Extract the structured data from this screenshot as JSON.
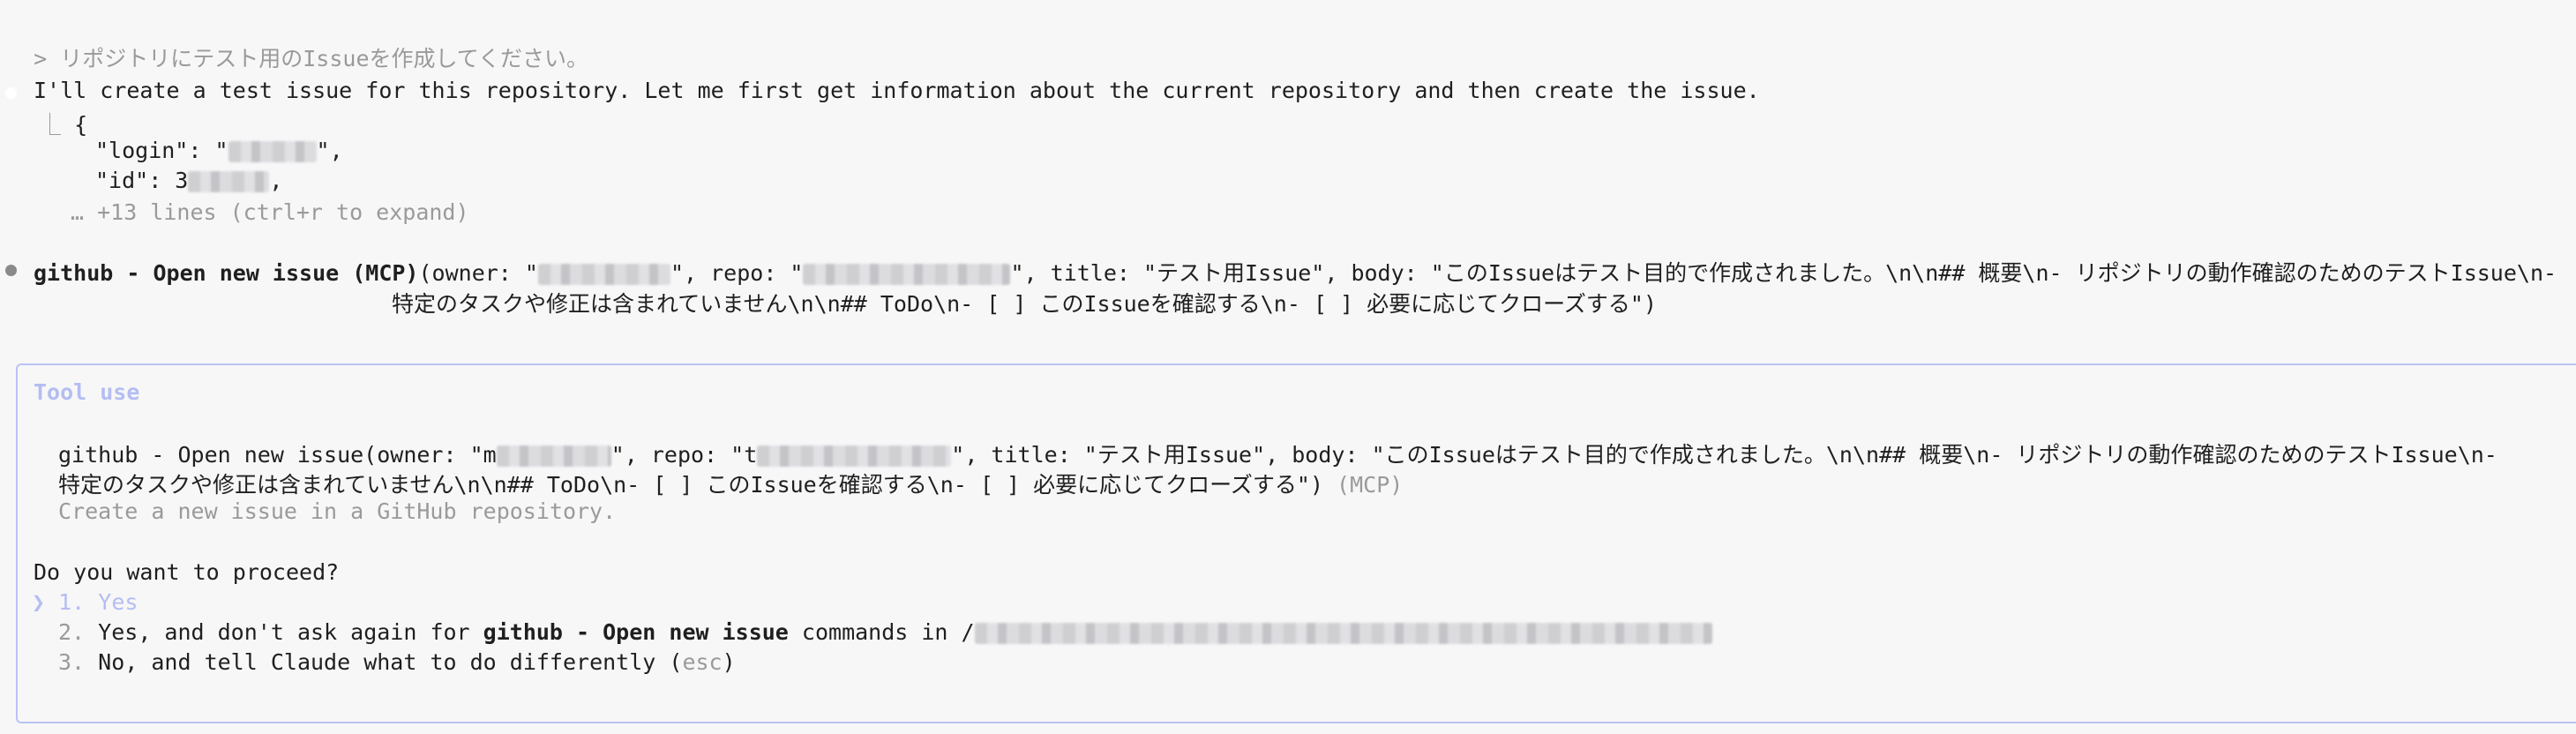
{
  "prompt": {
    "marker": ">",
    "text": "リポジトリにテスト用のIssueを作成してください。"
  },
  "assistant": {
    "message": "I'll create a test issue for this repository. Let me first get information about the current repository and then create the issue.",
    "tool_output": {
      "branch_glyph": "⎿",
      "open_brace": "{",
      "login_key": "\"login\": \"",
      "login_tail": "\",",
      "id_key": "\"id\": 3",
      "id_tail": ",",
      "more_lines": "… +13 lines (ctrl+r to expand)"
    }
  },
  "tool_call": {
    "name": "github - Open new issue (MCP)",
    "args_owner_prefix": "(owner: \"",
    "args_repo_prefix": "\", repo: \"",
    "args_rest_line1": "\", title: \"テスト用Issue\", body: \"このIssueはテスト目的で作成されました。\\n\\n## 概要\\n- リポジトリの動作確認のためのテストIssue\\n-",
    "args_line2": "特定のタスクや修正は含まれていません\\n\\n## ToDo\\n- [ ] このIssueを確認する\\n- [ ] 必要に応じてクローズする\")"
  },
  "tool_use_box": {
    "header": "Tool use",
    "call_owner_prefix": "github - Open new issue(owner: \"m",
    "call_repo_prefix": "\", repo: \"t",
    "call_rest_line1": "\", title: \"テスト用Issue\", body: \"このIssueはテスト目的で作成されました。\\n\\n## 概要\\n- リポジトリの動作確認のためのテストIssue\\n-",
    "call_line2": "特定のタスクや修正は含まれていません\\n\\n## ToDo\\n- [ ] このIssueを確認する\\n- [ ] 必要に応じてクローズする\")",
    "call_suffix": " (MCP)",
    "description": "Create a new issue in a GitHub repository.",
    "question": "Do you want to proceed?",
    "options": [
      {
        "cursor": "❯",
        "number": "1.",
        "label": "Yes"
      },
      {
        "number": "2.",
        "label_a": "Yes, and don't ask again for ",
        "label_bold": "github - Open new issue",
        "label_b": " commands in ",
        "label_c": "/"
      },
      {
        "number": "3.",
        "label_a": "No, and tell Claude what to do differently (",
        "label_key": "esc",
        "label_b": ")"
      }
    ]
  },
  "colors": {
    "background": "#f7f7f8",
    "text": "#1f1f1f",
    "muted": "#9a9a9a",
    "accent": "#b4bdf2",
    "box_border": "#b9c3f5"
  }
}
